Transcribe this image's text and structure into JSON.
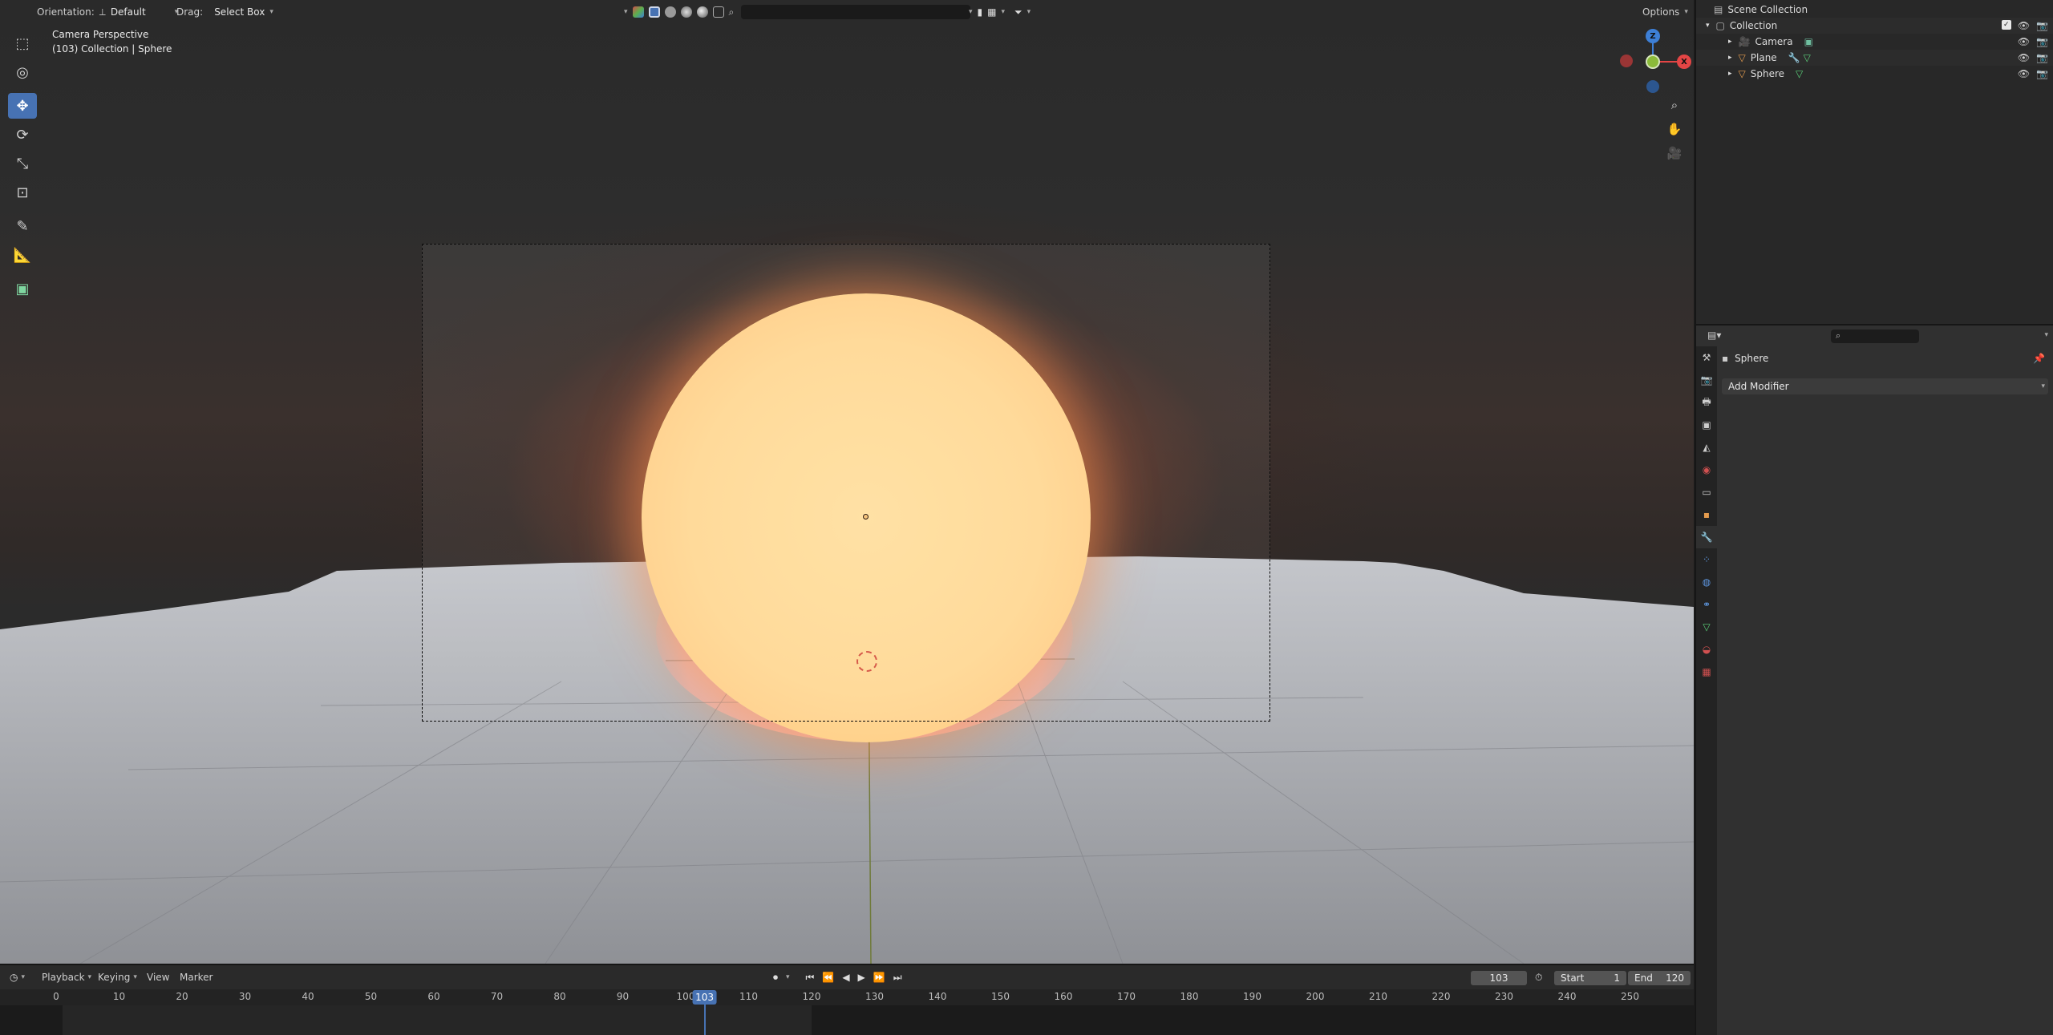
{
  "viewport": {
    "header": {
      "orientation_label": "Orientation:",
      "orientation_value": "Default",
      "drag_label": "Drag:",
      "drag_value": "Select Box",
      "options_label": "Options"
    },
    "info": {
      "line1": "Camera Perspective",
      "line2": "(103) Collection | Sphere"
    },
    "gizmo": {
      "z": "Z",
      "x": "X"
    },
    "tools": [
      "select-box-icon",
      "cursor-icon",
      "move-icon",
      "rotate-icon",
      "scale-icon",
      "transform-icon",
      "annotate-icon",
      "measure-icon",
      "add-cube-icon"
    ],
    "nav_buttons": [
      "zoom-icon",
      "pan-hand-icon",
      "camera-view-icon"
    ]
  },
  "outliner": {
    "rows": [
      {
        "label": "Scene Collection",
        "indent": 0
      },
      {
        "label": "Collection",
        "indent": 1
      },
      {
        "label": "Camera",
        "indent": 2
      },
      {
        "label": "Plane",
        "indent": 2
      },
      {
        "label": "Sphere",
        "indent": 2
      }
    ]
  },
  "properties": {
    "object_name": "Sphere",
    "add_modifier_label": "Add Modifier",
    "tabs": [
      "tool-tab",
      "render-tab",
      "output-tab",
      "view-layer-tab",
      "scene-tab",
      "world-tab",
      "collection-tab",
      "object-tab",
      "modifier-tab",
      "particles-tab",
      "physics-tab",
      "constraints-tab",
      "data-tab",
      "material-tab",
      "texture-tab"
    ]
  },
  "timeline": {
    "menus": [
      "Playback",
      "Keying",
      "View",
      "Marker"
    ],
    "current_frame": "103",
    "start_label": "Start",
    "start_value": "1",
    "end_label": "End",
    "end_value": "120",
    "ticks": [
      "0",
      "10",
      "20",
      "30",
      "40",
      "50",
      "60",
      "70",
      "80",
      "90",
      "100",
      "110",
      "120",
      "130",
      "140",
      "150",
      "160",
      "170",
      "180",
      "190",
      "200",
      "210",
      "220",
      "230",
      "240",
      "250"
    ],
    "playhead_frame": "103"
  },
  "colors": {
    "accent": "#4772b3",
    "x_axis": "#e44545",
    "y_axis": "#8bbb3a",
    "z_axis": "#3d7fd6"
  }
}
